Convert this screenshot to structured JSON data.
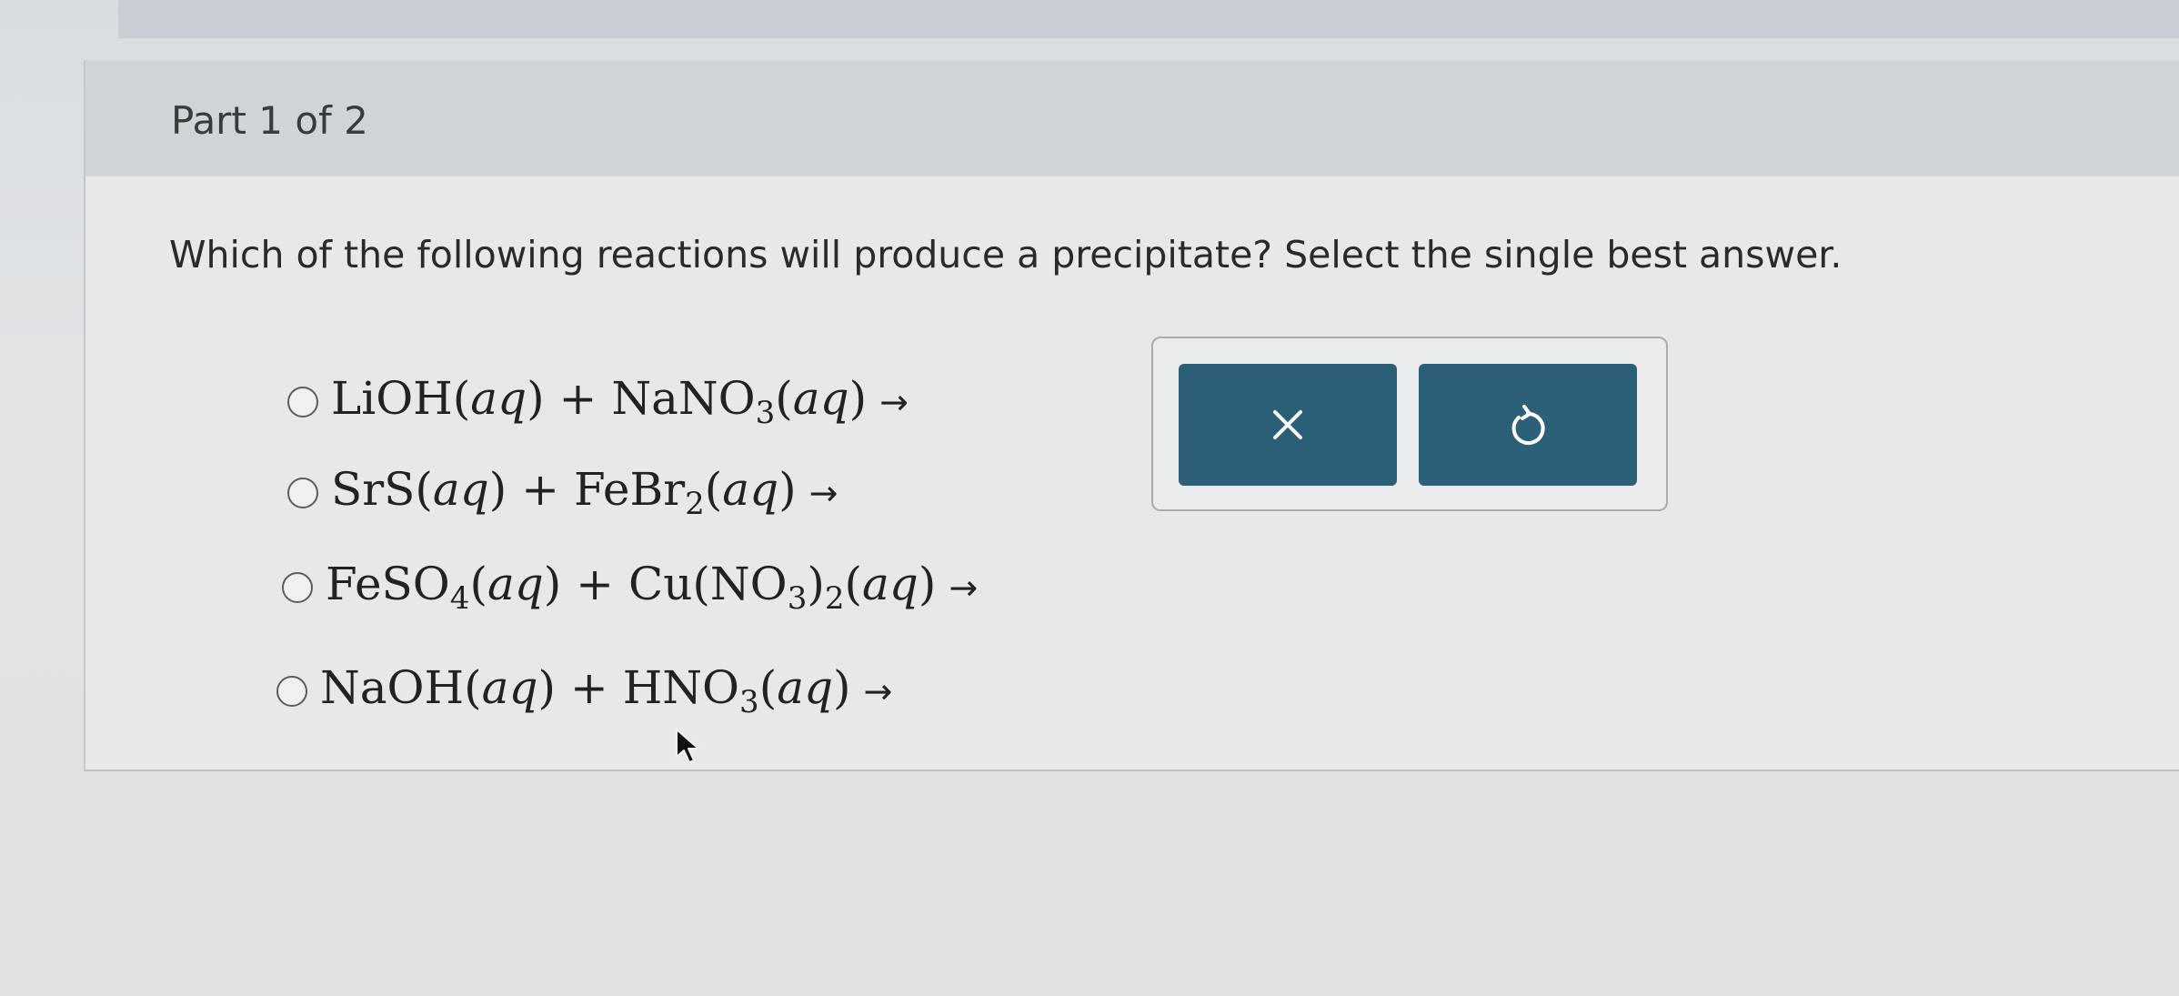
{
  "part": {
    "label": "Part 1 of 2"
  },
  "question": {
    "text": "Which of the following reactions will produce a precipitate? Select the single best answer."
  },
  "options": [
    {
      "id": "option-lioh-nano3",
      "selected": false
    },
    {
      "id": "option-srs-febr2",
      "selected": false
    },
    {
      "id": "option-feso4-cuno32",
      "selected": false
    },
    {
      "id": "option-naoh-hno3",
      "selected": false
    }
  ],
  "tools": {
    "clear_icon": "close-icon",
    "undo_icon": "undo-icon",
    "button_color": "#2c5f78"
  }
}
